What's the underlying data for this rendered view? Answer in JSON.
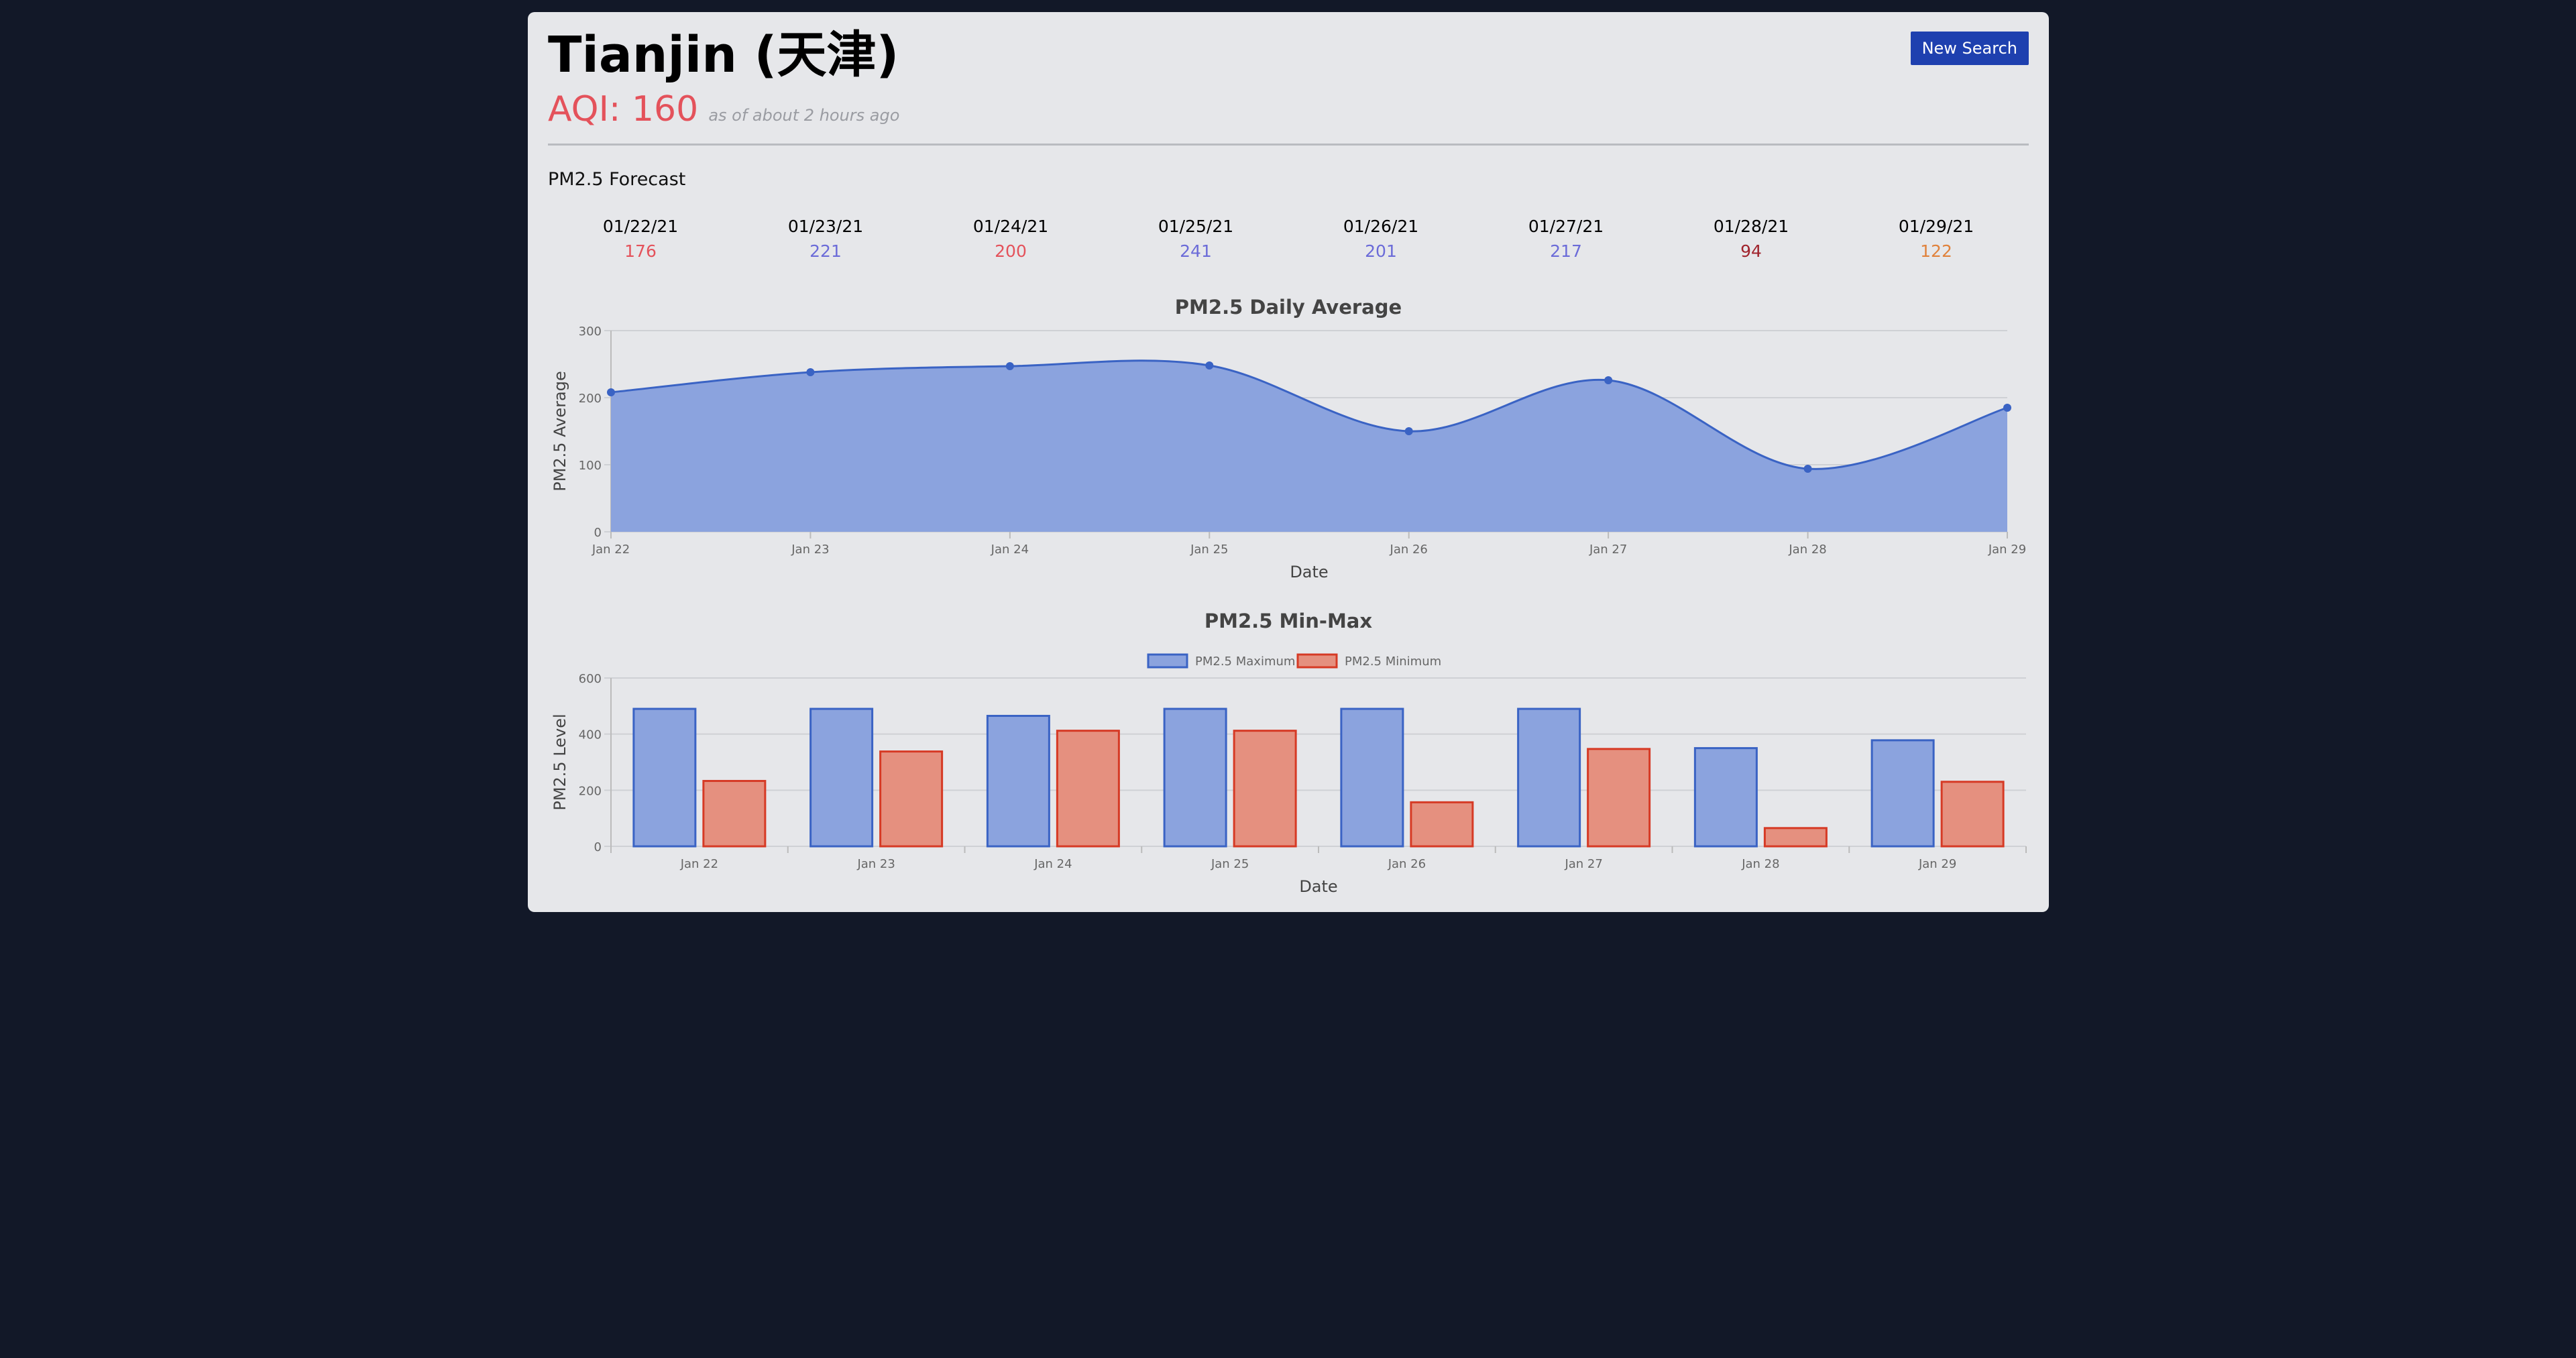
{
  "header": {
    "city": "Tianjin (天津)",
    "aqi": "AQI: 160",
    "updated": "as of about 2 hours ago",
    "new_search_label": "New Search"
  },
  "forecast": {
    "label": "PM2.5 Forecast",
    "days": [
      {
        "date": "01/22/21",
        "value": "176",
        "color": "#e4525b"
      },
      {
        "date": "01/23/21",
        "value": "221",
        "color": "#6b6bd8"
      },
      {
        "date": "01/24/21",
        "value": "200",
        "color": "#e4525b"
      },
      {
        "date": "01/25/21",
        "value": "241",
        "color": "#6b6bd8"
      },
      {
        "date": "01/26/21",
        "value": "201",
        "color": "#6b6bd8"
      },
      {
        "date": "01/27/21",
        "value": "217",
        "color": "#6b6bd8"
      },
      {
        "date": "01/28/21",
        "value": "94",
        "color": "#a0242d"
      },
      {
        "date": "01/29/21",
        "value": "122",
        "color": "#e0823c"
      }
    ]
  },
  "chart_data": [
    {
      "type": "area",
      "title": "PM2.5 Daily Average",
      "xlabel": "Date",
      "ylabel": "PM2.5 Average",
      "categories": [
        "Jan 22",
        "Jan 23",
        "Jan 24",
        "Jan 25",
        "Jan 26",
        "Jan 27",
        "Jan 28",
        "Jan 29"
      ],
      "values": [
        208,
        238,
        247,
        248,
        150,
        226,
        94,
        185
      ],
      "ylim": [
        0,
        300
      ],
      "yticks": [
        0,
        100,
        200,
        300
      ],
      "grid": true,
      "colors": {
        "fill": "#8ba3de",
        "line": "#3a63c4"
      }
    },
    {
      "type": "bar",
      "title": "PM2.5 Min-Max",
      "xlabel": "Date",
      "ylabel": "PM2.5 Level",
      "categories": [
        "Jan 22",
        "Jan 23",
        "Jan 24",
        "Jan 25",
        "Jan 26",
        "Jan 27",
        "Jan 28",
        "Jan 29"
      ],
      "series": [
        {
          "name": "PM2.5 Maximum",
          "values": [
            490,
            490,
            465,
            490,
            490,
            490,
            350,
            378
          ],
          "fill": "#8ba3de",
          "stroke": "#3a63c4"
        },
        {
          "name": "PM2.5 Minimum",
          "values": [
            233,
            338,
            412,
            412,
            157,
            347,
            65,
            230
          ],
          "fill": "#e5907f",
          "stroke": "#d63a25"
        }
      ],
      "ylim": [
        0,
        600
      ],
      "yticks": [
        0,
        200,
        400,
        600
      ],
      "grid": true,
      "legend": "top"
    }
  ]
}
